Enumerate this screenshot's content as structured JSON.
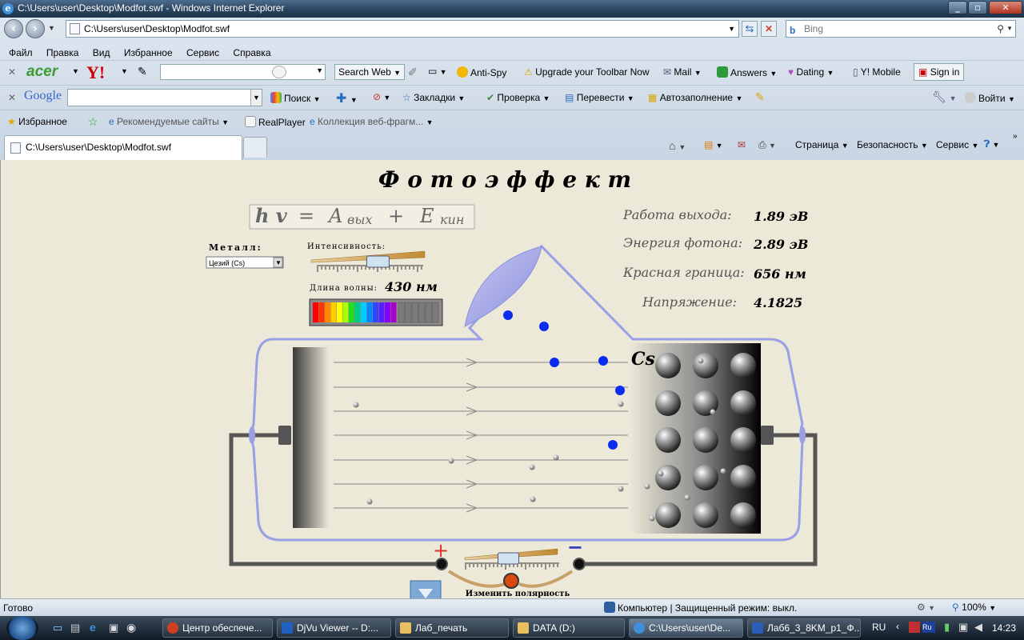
{
  "window": {
    "title": "C:\\Users\\user\\Desktop\\Modfot.swf - Windows Internet Explorer"
  },
  "address_bar": {
    "url": "C:\\Users\\user\\Desktop\\Modfot.swf",
    "search_placeholder": "Bing"
  },
  "menu": [
    "Файл",
    "Правка",
    "Вид",
    "Избранное",
    "Сервис",
    "Справка"
  ],
  "acer_toolbar": {
    "brand": "acer",
    "yahoo": "Y!",
    "search_web": "Search Web",
    "anti_spy": "Anti-Spy",
    "upgrade": "Upgrade your Toolbar Now",
    "mail": "Mail",
    "answers": "Answers",
    "dating": "Dating",
    "mobile": "Y! Mobile",
    "sign_in": "Sign in"
  },
  "google_toolbar": {
    "brand": "Google",
    "search": "Поиск",
    "bookmarks": "Закладки",
    "check": "Проверка",
    "translate": "Перевести",
    "autofill": "Автозаполнение",
    "login": "Войти"
  },
  "favorites_bar": {
    "favorites": "Избранное",
    "suggested": "Рекомендуемые сайты",
    "realplayer": "RealPlayer",
    "gallery": "Коллекция веб-фрагм..."
  },
  "tab": {
    "label": "C:\\Users\\user\\Desktop\\Modfot.swf"
  },
  "command_bar": {
    "page": "Страница",
    "safety": "Безопасность",
    "tools": "Сервис"
  },
  "sim": {
    "title": "Ф о т о э ф ф е к т",
    "formula": "hν = Aвых + Eкин",
    "formula_parts": {
      "hv": "h v",
      "eq": "=",
      "A": "A",
      "A_sub": "вых",
      "plus": "+",
      "E": "E",
      "E_sub": "кин"
    },
    "metal_label": "Металл:",
    "metal_value": "Цезий (Cs)",
    "intensity_label": "Интенсивность:",
    "wavelength_label": "Длина волны:",
    "wavelength_value": "430 нм",
    "intensity_level": 0.6,
    "voltage_level": 0.45,
    "readouts": [
      {
        "label": "Работа выхода:",
        "value": "1.89 эВ"
      },
      {
        "label": "Энергия фотона:",
        "value": "2.89 эВ"
      },
      {
        "label": "Красная граница:",
        "value": "656 нм"
      },
      {
        "label": "Напряжение:",
        "value": "4.1825"
      }
    ],
    "metal_symbol": "Cs",
    "plus_sign": "+",
    "minus_sign": "−",
    "polarity_button": "Изменить полярность",
    "spectrum_colors": [
      "#ff0000",
      "#ff3300",
      "#ff8800",
      "#ffcc00",
      "#ffff00",
      "#aaff00",
      "#22dd22",
      "#00cc88",
      "#00ccff",
      "#0088ff",
      "#3344ff",
      "#5522ff",
      "#8800ff",
      "#aa00cc"
    ]
  },
  "status_bar": {
    "text": "Готово",
    "zone": "Компьютер | Защищенный режим: выкл.",
    "zoom": "100%"
  },
  "taskbar": {
    "items": [
      "Центр обеспече...",
      "DjVu Viewer -- D:...",
      "Лаб_печать",
      "DATA (D:)",
      "C:\\Users\\user\\De...",
      "Лаб6_3_8KM_p1_Ф..."
    ],
    "lang": "RU",
    "clock": "14:23"
  }
}
